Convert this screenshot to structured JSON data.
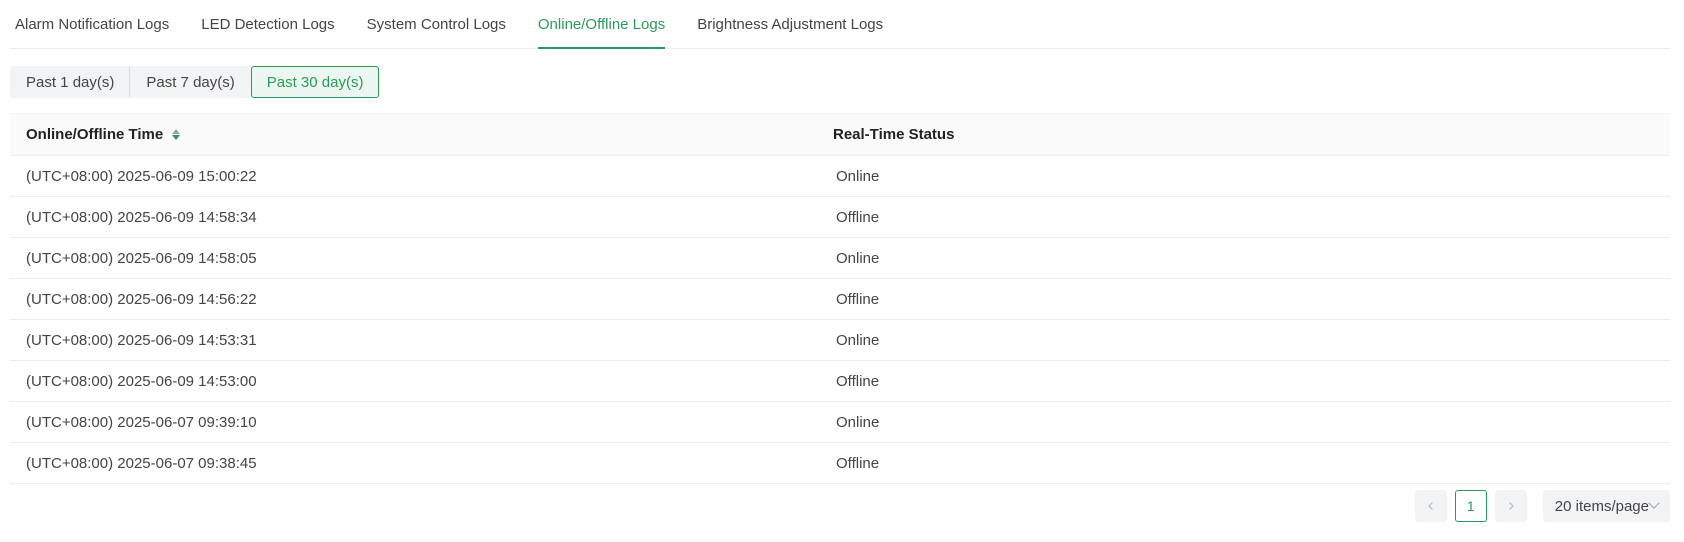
{
  "tabs": [
    {
      "label": "Alarm Notification Logs",
      "active": false
    },
    {
      "label": "LED Detection Logs",
      "active": false
    },
    {
      "label": "System Control Logs",
      "active": false
    },
    {
      "label": "Online/Offline Logs",
      "active": true
    },
    {
      "label": "Brightness Adjustment Logs",
      "active": false
    }
  ],
  "ranges": [
    {
      "label": "Past 1 day(s)",
      "active": false
    },
    {
      "label": "Past 7 day(s)",
      "active": false
    },
    {
      "label": "Past 30 day(s)",
      "active": true
    }
  ],
  "table": {
    "columns": {
      "time": "Online/Offline Time",
      "status": "Real-Time Status"
    },
    "rows": [
      {
        "time": "(UTC+08:00) 2025-06-09 15:00:22",
        "status": "Online"
      },
      {
        "time": "(UTC+08:00) 2025-06-09 14:58:34",
        "status": "Offline"
      },
      {
        "time": "(UTC+08:00) 2025-06-09 14:58:05",
        "status": "Online"
      },
      {
        "time": "(UTC+08:00) 2025-06-09 14:56:22",
        "status": "Offline"
      },
      {
        "time": "(UTC+08:00) 2025-06-09 14:53:31",
        "status": "Online"
      },
      {
        "time": "(UTC+08:00) 2025-06-09 14:53:00",
        "status": "Offline"
      },
      {
        "time": "(UTC+08:00) 2025-06-07 09:39:10",
        "status": "Online"
      },
      {
        "time": "(UTC+08:00) 2025-06-07 09:38:45",
        "status": "Offline"
      }
    ]
  },
  "pagination": {
    "current_page": "1",
    "page_size_label": "20 items/page"
  },
  "colors": {
    "accent": "#2a9a5c"
  },
  "icons": {
    "sort": "sort-icon",
    "prev": "chevron-left-icon",
    "next": "chevron-right-icon",
    "dropdown": "chevron-down-icon"
  }
}
